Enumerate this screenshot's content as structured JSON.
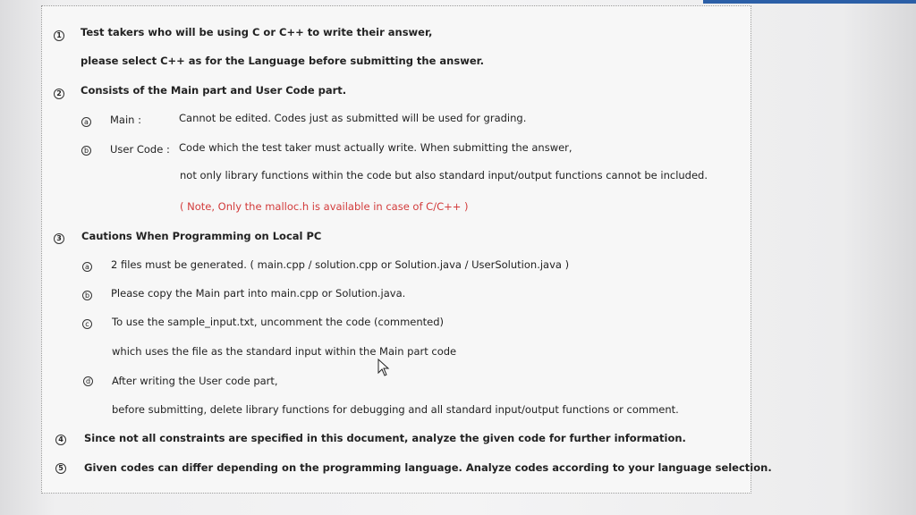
{
  "items": {
    "i1": {
      "marker": "1",
      "line1": "Test takers who will be using C or C++ to write their answer,",
      "line2": "please select C++ as for the Language before submitting the answer."
    },
    "i2": {
      "marker": "2",
      "title": "Consists of the Main part and User Code part.",
      "sub_a": {
        "marker": "a",
        "label": "Main :",
        "text": "Cannot be edited. Codes just as submitted will be used for grading."
      },
      "sub_b": {
        "marker": "b",
        "label": "User Code :",
        "text1": "Code which the test taker must actually write. When submitting the answer,",
        "text2": "not only library functions within the code but also standard input/output functions cannot be included.",
        "note": "( Note, Only the malloc.h is available in case of C/C++ )"
      }
    },
    "i3": {
      "marker": "3",
      "title": "Cautions When Programming on Local PC",
      "sub_a": {
        "marker": "a",
        "text": "2 files must be generated. ( main.cpp / solution.cpp or Solution.java / UserSolution.java )"
      },
      "sub_b": {
        "marker": "b",
        "text": "Please copy the Main part into main.cpp or Solution.java."
      },
      "sub_c": {
        "marker": "c",
        "text1": "To use the sample_input.txt, uncomment the code (commented)",
        "text2": "which uses the file as the standard input within the Main part code"
      },
      "sub_d": {
        "marker": "d",
        "text1": "After writing the User code part,",
        "text2": "before submitting, delete library functions for debugging and all standard input/output functions or comment."
      }
    },
    "i4": {
      "marker": "4",
      "text": "Since not all constraints are specified in this document, analyze the given code for further information."
    },
    "i5": {
      "marker": "5",
      "text": "Given codes can differ depending on the programming language. Analyze codes according to your language selection."
    }
  },
  "colors": {
    "note_red": "#d23b3b",
    "accent": "#2b5fa7"
  }
}
